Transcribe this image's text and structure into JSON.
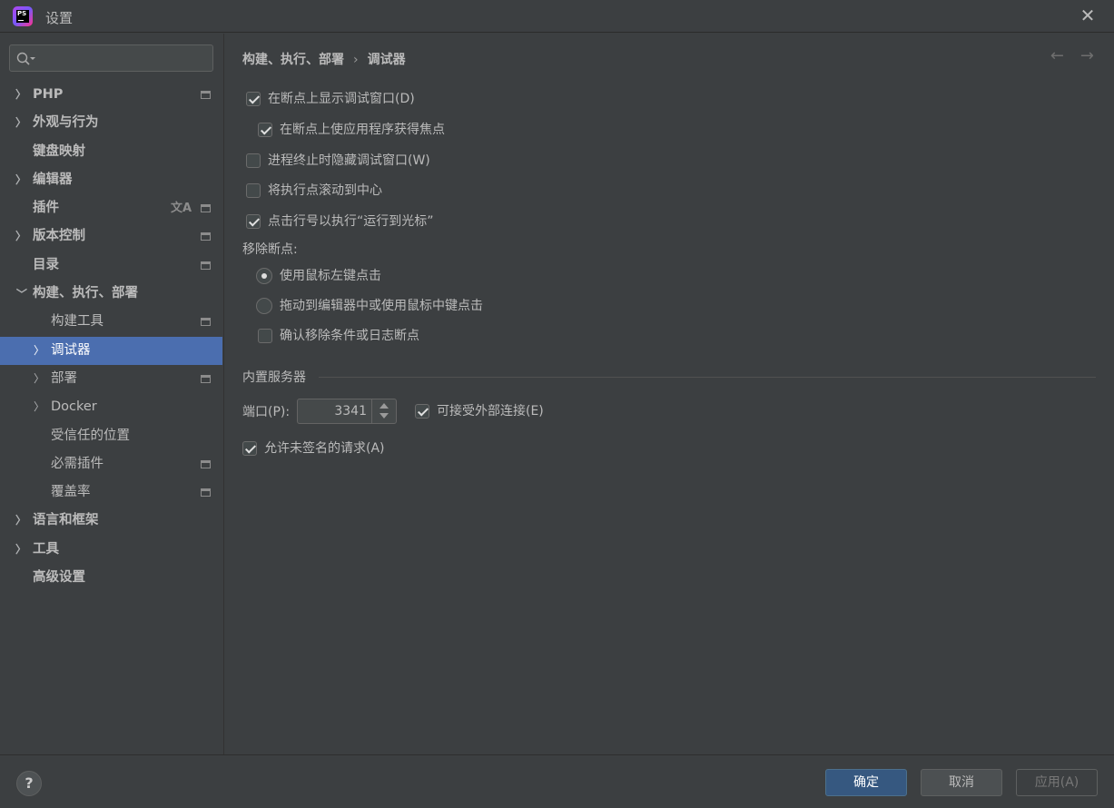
{
  "window": {
    "title": "设置"
  },
  "search": {
    "placeholder": ""
  },
  "sidebar": {
    "items": [
      {
        "label": "PHP"
      },
      {
        "label": "外观与行为"
      },
      {
        "label": "键盘映射"
      },
      {
        "label": "编辑器"
      },
      {
        "label": "插件"
      },
      {
        "label": "版本控制"
      },
      {
        "label": "目录"
      },
      {
        "label": "构建、执行、部署"
      },
      {
        "label": "构建工具"
      },
      {
        "label": "调试器"
      },
      {
        "label": "部署"
      },
      {
        "label": "Docker"
      },
      {
        "label": "受信任的位置"
      },
      {
        "label": "必需插件"
      },
      {
        "label": "覆盖率"
      },
      {
        "label": "语言和框架"
      },
      {
        "label": "工具"
      },
      {
        "label": "高级设置"
      }
    ]
  },
  "breadcrumb": {
    "parent": "构建、执行、部署",
    "separator": "›",
    "current": "调试器"
  },
  "nav": {
    "back": "←",
    "forward": "→"
  },
  "debugger": {
    "show_window_on_breakpoint": {
      "label": "在断点上显示调试窗口(D)",
      "checked": true
    },
    "focus_on_breakpoint": {
      "label": "在断点上使应用程序获得焦点",
      "checked": true
    },
    "hide_window_on_terminate": {
      "label": "进程终止时隐藏调试窗口(W)",
      "checked": false
    },
    "scroll_to_center": {
      "label": "将执行点滚动到中心",
      "checked": false
    },
    "click_line_run_to_cursor": {
      "label": "点击行号以执行“运行到光标”",
      "checked": true
    },
    "remove_breakpoints_label": "移除断点:",
    "remove_left_click": {
      "label": "使用鼠标左键点击",
      "selected": true
    },
    "remove_drag_middle": {
      "label": "拖动到编辑器中或使用鼠标中键点击",
      "selected": false
    },
    "confirm_remove_conditional": {
      "label": "确认移除条件或日志断点",
      "checked": false
    }
  },
  "builtin_server": {
    "section_title": "内置服务器",
    "port_label": "端口(P):",
    "port_value": "3341",
    "accept_external": {
      "label": "可接受外部连接(E)",
      "checked": true
    },
    "allow_unsigned": {
      "label": "允许未签名的请求(A)",
      "checked": true
    }
  },
  "footer": {
    "help": "?",
    "ok": "确定",
    "cancel": "取消",
    "apply": "应用(A)"
  },
  "colors": {
    "background": "#3c3f41",
    "selection": "#4b6eaf",
    "primary_button": "#365880",
    "text": "#bbbbbb"
  }
}
